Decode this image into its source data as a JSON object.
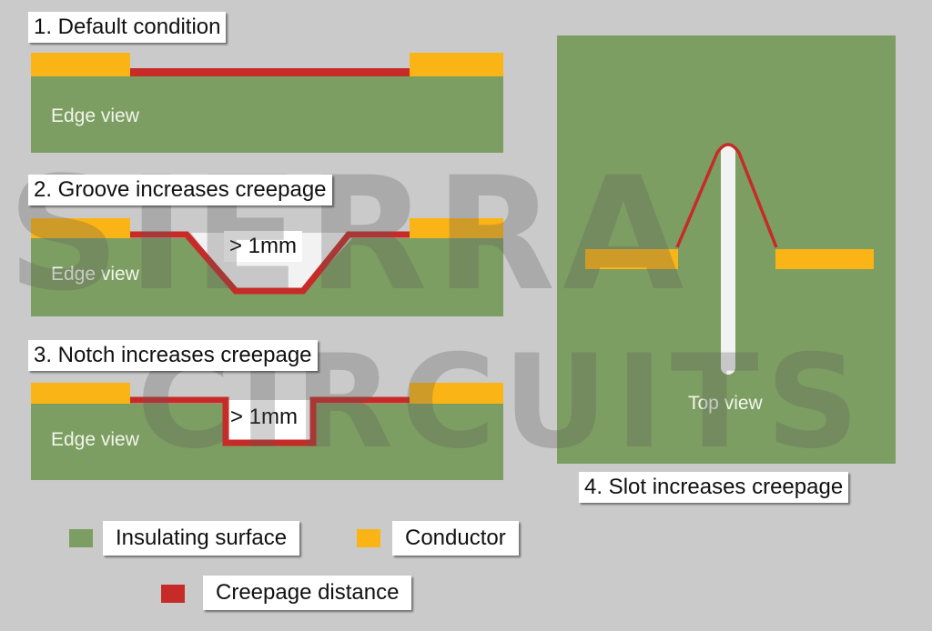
{
  "colors": {
    "insulating": "#7d9e62",
    "conductor": "#fbb415",
    "creepage": "#c62b28",
    "background": "#cacaca",
    "slot": "#f2f2f2"
  },
  "panels": [
    {
      "title": "1. Default condition",
      "view_label": "Edge view"
    },
    {
      "title": "2. Groove increases creepage",
      "view_label": "Edge view",
      "dimension": "> 1mm"
    },
    {
      "title": "3. Notch increases creepage",
      "view_label": "Edge view",
      "dimension": "> 1mm"
    },
    {
      "title": "4. Slot increases creepage",
      "view_label": "Top view"
    }
  ],
  "legend": [
    {
      "label": "Insulating surface",
      "color": "#7d9e62"
    },
    {
      "label": "Conductor",
      "color": "#fbb415"
    },
    {
      "label": "Creepage distance",
      "color": "#c62b28"
    }
  ],
  "watermark": {
    "line1": "SIERRA",
    "line2": "CIRCUITS"
  }
}
